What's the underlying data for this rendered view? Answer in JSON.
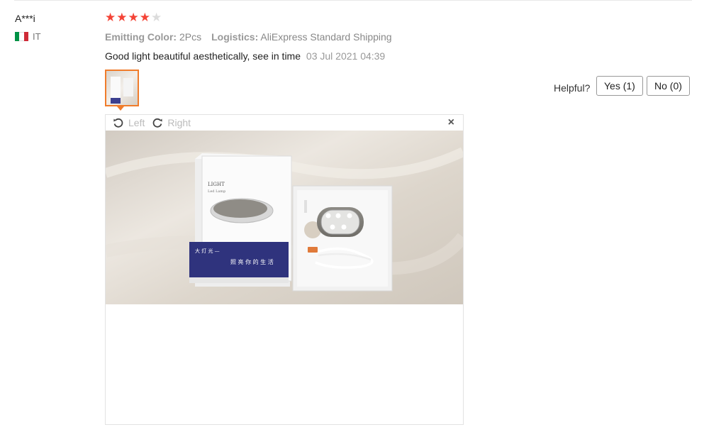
{
  "reviewer": {
    "name": "A***i",
    "country_code": "IT",
    "flag_colors": [
      "#009246",
      "#ffffff",
      "#ce2b37"
    ]
  },
  "rating": {
    "stars": 4,
    "max": 5
  },
  "attributes": [
    {
      "key": "Emitting Color:",
      "value": "2Pcs"
    },
    {
      "key": "Logistics:",
      "value": "AliExpress Standard Shipping"
    }
  ],
  "review": {
    "text": "Good light beautiful aesthetically, see in time",
    "date": "03 Jul 2021 04:39"
  },
  "helpful": {
    "label": "Helpful?",
    "yes_label": "Yes (1)",
    "no_label": "No (0)"
  },
  "viewer": {
    "rotate_left_label": "Left",
    "rotate_right_label": "Right",
    "close_icon": "×",
    "photo_text": {
      "box_brand": "LIGHT",
      "box_subtitle": "Led Lamp",
      "box_tagline_1": "大 灯 光 —",
      "box_tagline_2": "照 亮 你 的 生 活"
    }
  },
  "colors": {
    "star_active": "#f44336",
    "star_inactive": "#dcdcdc",
    "thumb_border": "#f07c2b"
  }
}
